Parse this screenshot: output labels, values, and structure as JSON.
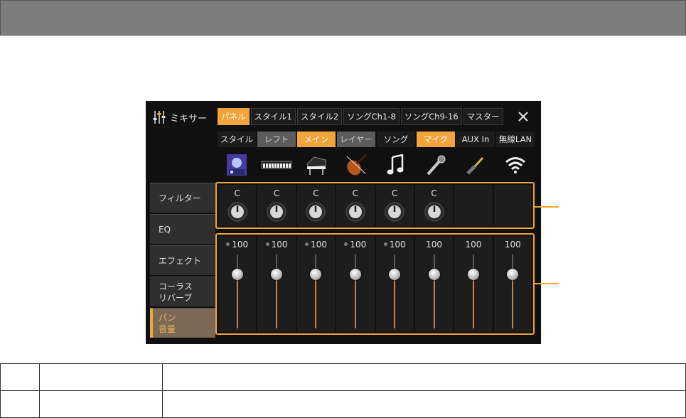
{
  "mixer": {
    "title": "ミキサー",
    "tabs": [
      {
        "label": "パネル",
        "active": true
      },
      {
        "label": "スタイル1",
        "active": false
      },
      {
        "label": "スタイル2",
        "active": false
      },
      {
        "label": "ソングCh1-8",
        "active": false
      },
      {
        "label": "ソングCh9-16",
        "active": false
      },
      {
        "label": "マスター",
        "active": false
      }
    ],
    "parts": [
      {
        "label": "スタイル",
        "state": "normal",
        "icon": "mic-stand-icon"
      },
      {
        "label": "レフト",
        "state": "gray",
        "icon": "keyboard-icon"
      },
      {
        "label": "メイン",
        "state": "orange",
        "icon": "grand-piano-icon"
      },
      {
        "label": "レイヤー",
        "state": "gray",
        "icon": "violin-icon"
      },
      {
        "label": "ソング",
        "state": "normal",
        "icon": "music-note-icon"
      },
      {
        "label": "マイク",
        "state": "orange",
        "icon": "microphone-icon"
      },
      {
        "label": "AUX In",
        "state": "normal",
        "icon": "audio-plug-icon"
      },
      {
        "label": "無線LAN",
        "state": "normal",
        "icon": "wifi-icon"
      }
    ],
    "side_menu": [
      {
        "line1": "フィルター",
        "line2": "",
        "active": false
      },
      {
        "line1": "EQ",
        "line2": "",
        "active": false
      },
      {
        "line1": "エフェクト",
        "line2": "",
        "active": false
      },
      {
        "line1": "コーラス",
        "line2": "リバーブ",
        "active": false
      },
      {
        "line1": "パン",
        "line2": "音量",
        "active": true
      }
    ],
    "pan_values": [
      "C",
      "C",
      "C",
      "C",
      "C",
      "C",
      "",
      ""
    ],
    "volume_values": [
      "100",
      "100",
      "100",
      "100",
      "100",
      "100",
      "100",
      "100"
    ],
    "volume_has_dot": [
      true,
      true,
      true,
      true,
      true,
      false,
      false,
      false
    ],
    "accent_color": "#f0a43a"
  }
}
